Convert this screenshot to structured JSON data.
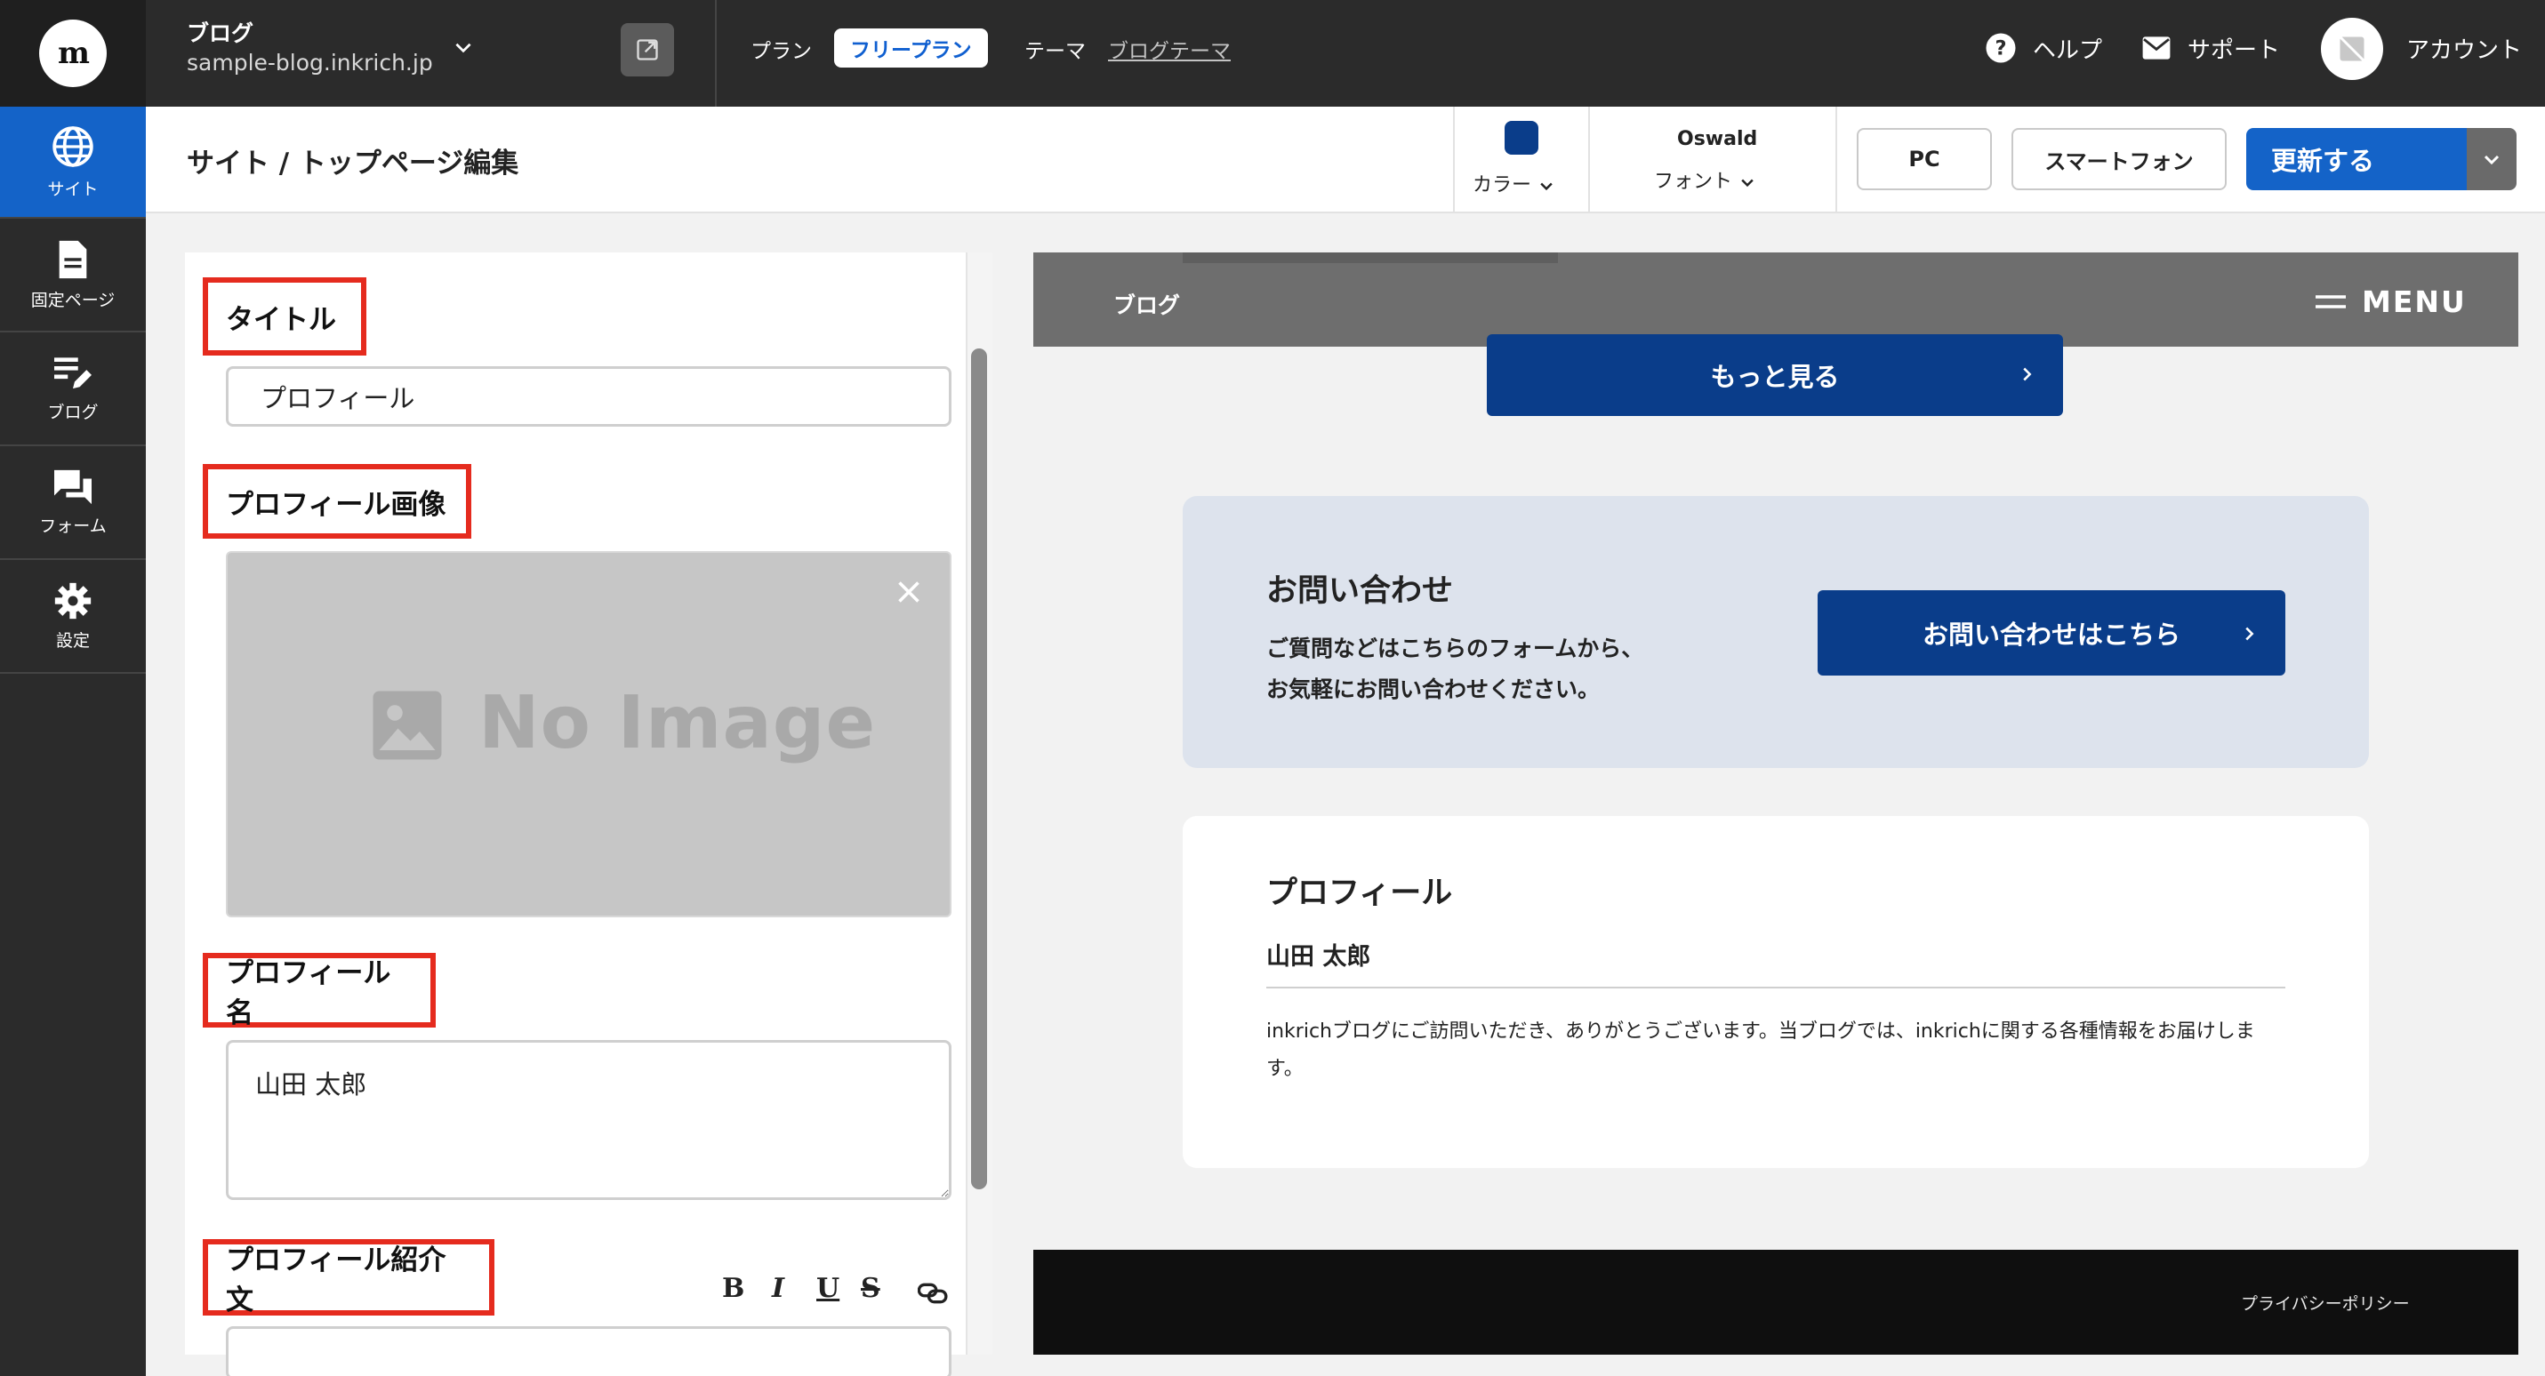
{
  "topbar": {
    "site_label": "ブログ",
    "site_domain": "sample-blog.inkrich.jp",
    "plan_label": "プラン",
    "plan_badge": "フリープラン",
    "theme_label": "テーマ",
    "theme_link": "ブログテーマ",
    "help_label": "ヘルプ",
    "support_label": "サポート",
    "account_label": "アカウント"
  },
  "sidebar": {
    "items": [
      {
        "label": "サイト",
        "icon": "globe-icon",
        "active": true
      },
      {
        "label": "固定ページ",
        "icon": "document-icon",
        "active": false
      },
      {
        "label": "ブログ",
        "icon": "edit-list-icon",
        "active": false
      },
      {
        "label": "フォーム",
        "icon": "chat-icon",
        "active": false
      },
      {
        "label": "設定",
        "icon": "gear-icon",
        "active": false
      }
    ]
  },
  "subheader": {
    "breadcrumb": "サイト / トップページ編集",
    "color_label": "カラー",
    "font_name": "Oswald",
    "font_label": "フォント",
    "pc_button": "PC",
    "smartphone_button": "スマートフォン",
    "update_button": "更新する"
  },
  "editor": {
    "title_label": "タイトル",
    "title_value": "プロフィール",
    "image_label": "プロフィール画像",
    "no_image_text": "No Image",
    "name_label": "プロフィール名",
    "name_value": "山田 太郎",
    "intro_label": "プロフィール紹介文",
    "rte": {
      "bold": "B",
      "italic": "I",
      "underline": "U",
      "strike": "S"
    }
  },
  "preview": {
    "header_label": "ブログ",
    "menu_label": "MENU",
    "more_button": "もっと見る",
    "contact_title": "お問い合わせ",
    "contact_line1": "ご質問などはこちらのフォームから、",
    "contact_line2": "お気軽にお問い合わせください。",
    "contact_button": "お問い合わせはこちら",
    "profile_title": "プロフィール",
    "profile_name": "山田 太郎",
    "profile_text": "inkrichブログにご訪問いただき、ありがとうございます。当ブログでは、inkrichに関する各種情報をお届けします。",
    "privacy_link": "プライバシーポリシー"
  },
  "colors": {
    "accent_blue": "#1463c8",
    "brand_navy": "#0a3d8a",
    "highlight_red": "#e52b1e"
  }
}
